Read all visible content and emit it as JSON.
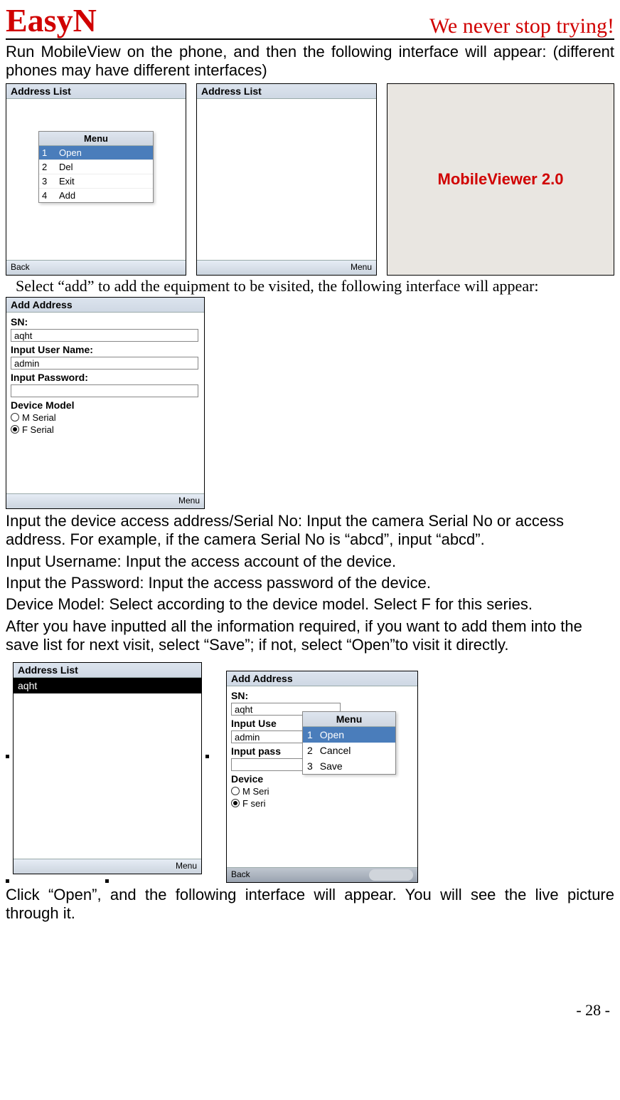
{
  "header": {
    "brand": "EasyN",
    "slogan": "We never stop trying!"
  },
  "intro_text": "Run MobileView on the phone, and then the following interface will appear: (different phones may have different interfaces)",
  "shot1": {
    "title": "Address List",
    "menu_title": "Menu",
    "items": [
      {
        "idx": "1",
        "label": "Open"
      },
      {
        "idx": "2",
        "label": "Del"
      },
      {
        "idx": "3",
        "label": "Exit"
      },
      {
        "idx": "4",
        "label": "Add"
      }
    ],
    "left_key": "Back"
  },
  "shot2": {
    "title": "Address List",
    "right_key": "Menu"
  },
  "shot3": {
    "splash": "MobileViewer 2.0"
  },
  "select_add_line": "Select “add” to add the equipment to be visited, the following interface will appear:",
  "shot4": {
    "title": "Add Address",
    "sn_label": "SN:",
    "sn_value": "aqht",
    "user_label": "Input User Name:",
    "user_value": "admin",
    "pass_label": "Input Password:",
    "pass_value": "",
    "model_label": "Device Model",
    "radio_m": "M Serial",
    "radio_f": "F Serial",
    "right_key": "Menu"
  },
  "instructions": [
    "Input the device access address/Serial No: Input the camera Serial No or access address. For example, if the camera Serial No is “abcd”, input “abcd”.",
    "Input Username: Input the access account of the device.",
    "Input the Password: Input the access password of the device.",
    "Device Model: Select according to the device model. Select F for this series.",
    "After you have inputted all the information required, if you want to add them into the save list for next visit, select “Save”; if not, select “Open”to visit it directly."
  ],
  "shot5": {
    "title": "Address List",
    "selected_item": "aqht",
    "right_key": "Menu"
  },
  "shot6": {
    "title": "Add Address",
    "sn_label": "SN:",
    "sn_value": "aqht",
    "user_label_short": "Input Use",
    "user_value": "admin",
    "pass_label_short": "Input pass",
    "model_label_short": "Device",
    "radio_m_short": "M Seri",
    "radio_f_short": "F seri",
    "menu_title": "Menu",
    "menu_items": [
      {
        "idx": "1",
        "label": "Open"
      },
      {
        "idx": "2",
        "label": "Cancel"
      },
      {
        "idx": "3",
        "label": "Save"
      }
    ],
    "left_key": "Back"
  },
  "open_line": "Click “Open”, and the following interface will appear. You will see the live picture through it.",
  "page_number": "- 28 -"
}
